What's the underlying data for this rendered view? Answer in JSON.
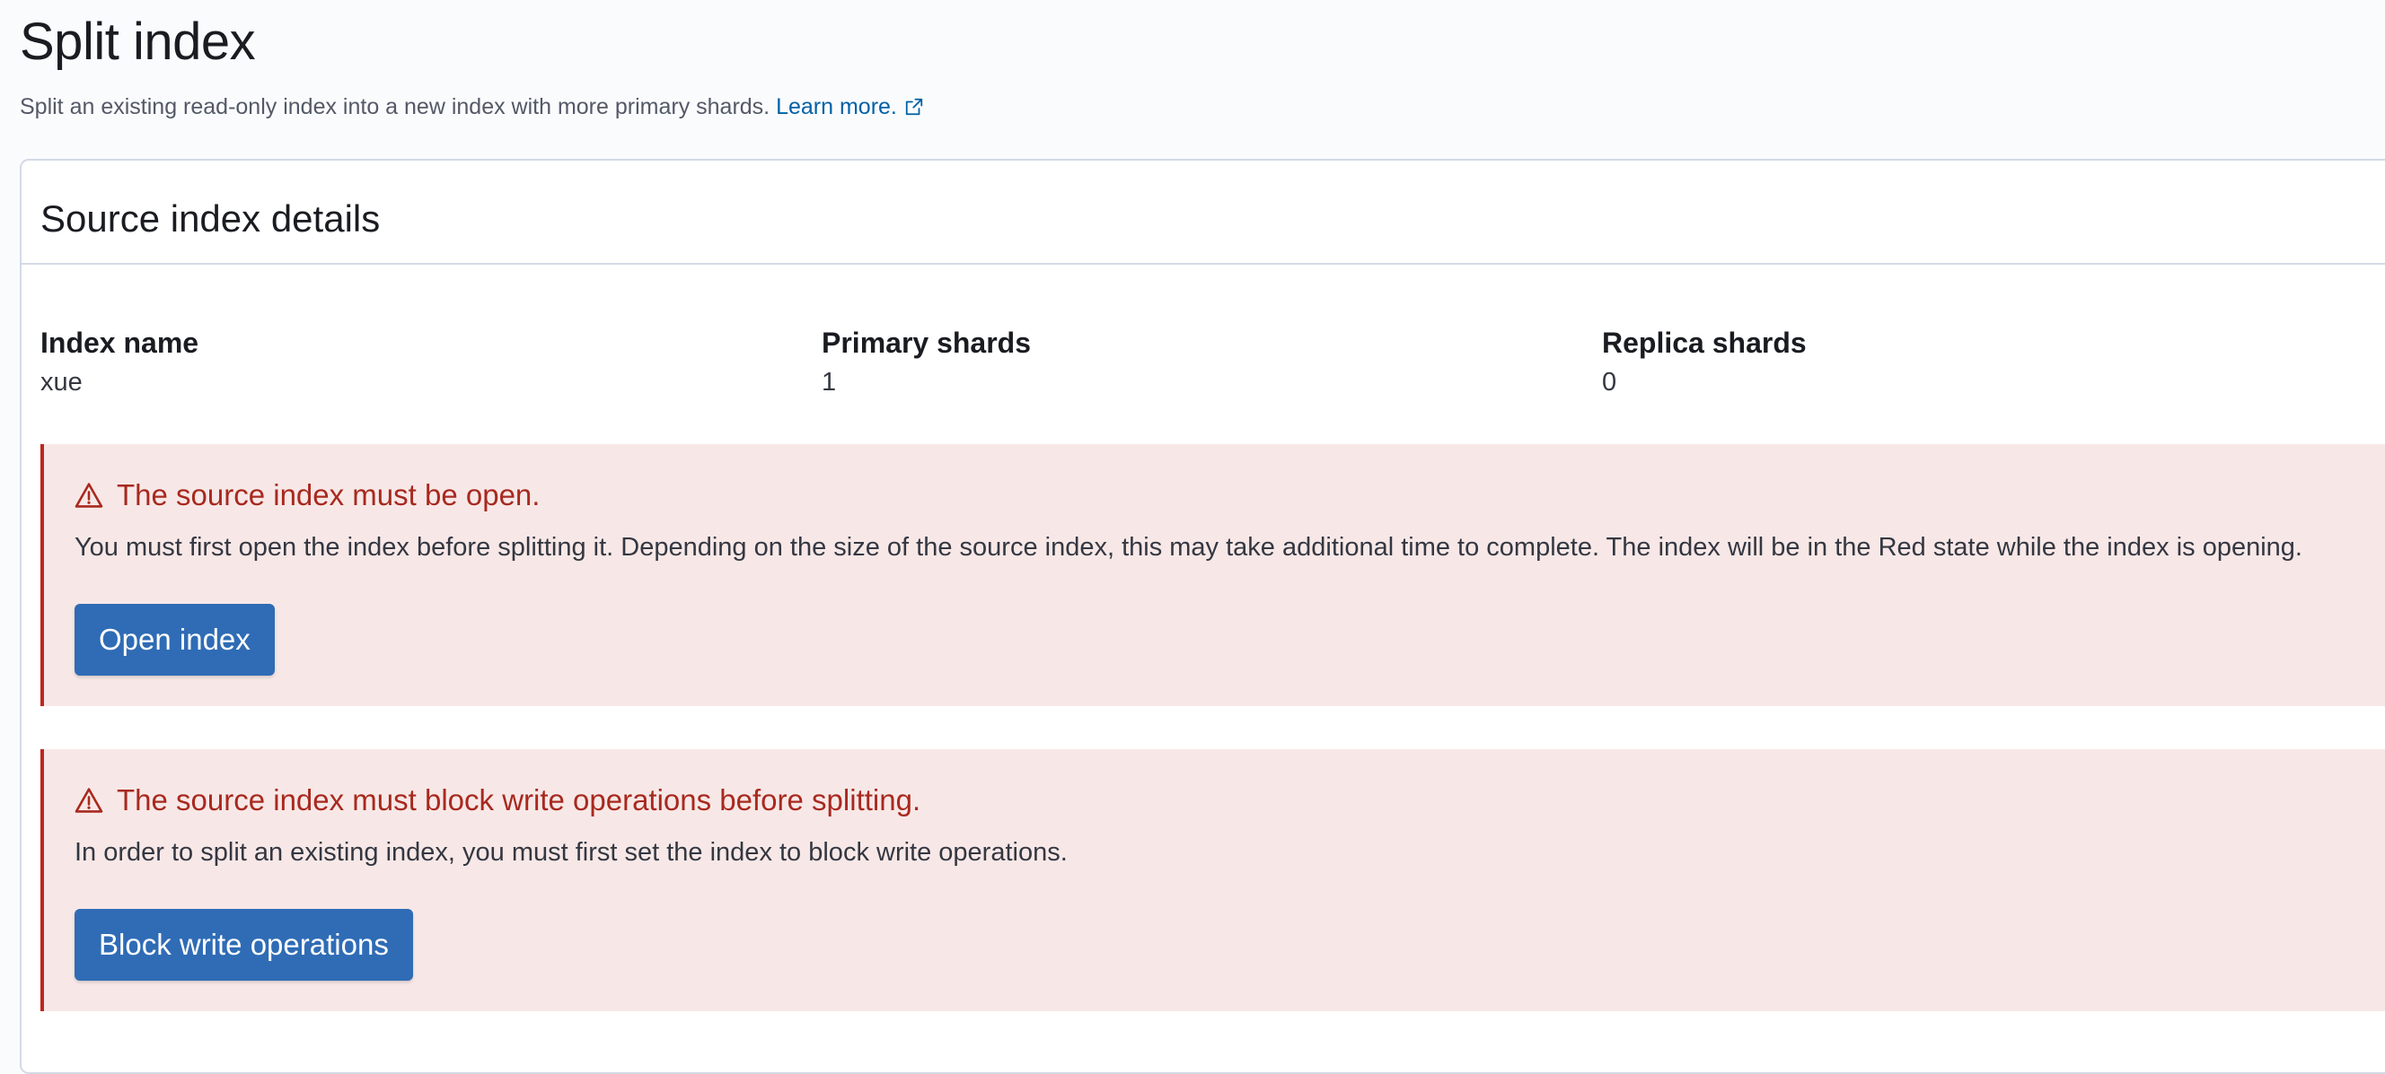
{
  "page": {
    "title": "Split index",
    "description": "Split an existing read-only index into a new index with more primary shards.",
    "learn_more_label": "Learn more.",
    "learn_more_icon": "external-link-icon"
  },
  "source_panel": {
    "title": "Source index details",
    "stats": [
      {
        "label": "Index name",
        "value": "xue"
      },
      {
        "label": "Primary shards",
        "value": "1"
      },
      {
        "label": "Replica shards",
        "value": "0"
      }
    ]
  },
  "callouts": [
    {
      "icon": "warning-icon",
      "title": "The source index must be open.",
      "text": "You must first open the index before splitting it. Depending on the size of the source index, this may take additional time to complete. The index will be in the Red state while the index is opening.",
      "button_label": "Open index"
    },
    {
      "icon": "warning-icon",
      "title": "The source index must block write operations before splitting.",
      "text": "In order to split an existing index, you must first set the index to block write operations.",
      "button_label": "Block write operations"
    }
  ],
  "colors": {
    "page_background": "#fafbfd",
    "link": "#0061a6",
    "danger_text": "#a8291f",
    "danger_background": "#f7e8e7",
    "danger_border": "#bd271e",
    "primary_button": "#2f6cb5"
  }
}
